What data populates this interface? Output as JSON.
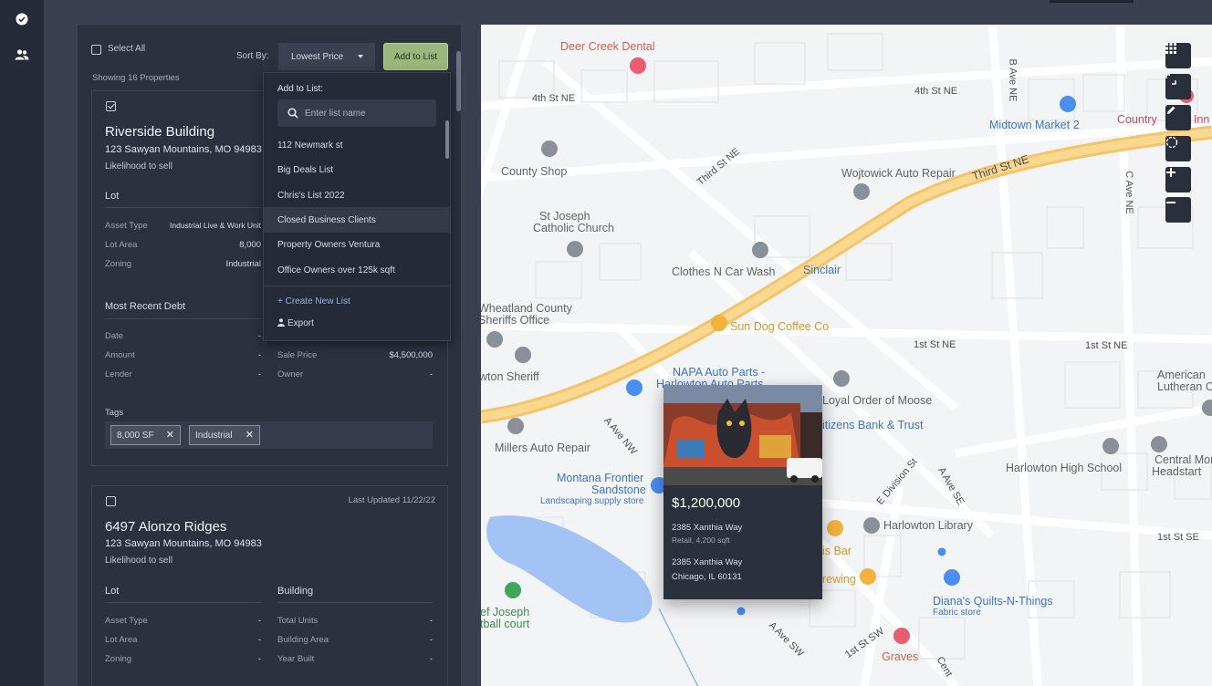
{
  "nav": {
    "items": [
      {
        "icon": "check-circle-icon"
      },
      {
        "icon": "users-icon"
      }
    ]
  },
  "list": {
    "select_all": "Select All",
    "sort_by_label": "Sort By:",
    "sort_value": "Lowest Price",
    "add_to_list": "Add to List",
    "showing": "Showing 16 Properties"
  },
  "dropdown": {
    "header": "Add to List:",
    "search_placeholder": "Enter list name",
    "items": [
      "112 Newmark st",
      "Big Deals List",
      "Chris's List 2022",
      "Closed Business Clients",
      "Property Owners Ventura",
      "Office Owners over 125k sqft"
    ],
    "create_new": "+ Create New List",
    "export": "Export"
  },
  "cards": [
    {
      "title": "Riverside Building",
      "address": "123 Sawyan Mountains, MO 94983",
      "likelihood": "Likelihood to sell",
      "lot_heading": "Lot",
      "asset_type_label": "Asset Type",
      "asset_type": "Industrial Live & Work Unit",
      "lot_area_label": "Lot Area",
      "lot_area": "8,000",
      "zoning_label": "Zoning",
      "zoning": "Industrial",
      "debt_heading": "Most Recent Debt",
      "date_label": "Date",
      "date": "-",
      "amount_label": "Amount",
      "amount": "-",
      "lender_label": "Lender",
      "lender": "-",
      "sale_price_label": "Sale Price",
      "sale_price": "$4,500,000",
      "owner_label": "Owner",
      "owner": "-",
      "tags_label": "Tags",
      "tags": [
        "8,000 SF",
        "Industrial"
      ]
    },
    {
      "last_updated": "Last Updated 11/22/22",
      "title": "6497 Alonzo Ridges",
      "address": "123 Sawyan Mountains, MO 94983",
      "likelihood": "Likelihood to sell",
      "lot_heading": "Lot",
      "building_heading": "Building",
      "asset_type_label": "Asset Type",
      "asset_type": "-",
      "lot_area_label": "Lot Area",
      "lot_area": "-",
      "zoning_label": "Zoning",
      "zoning": "-",
      "total_units_label": "Total Units",
      "total_units": "-",
      "building_area_label": "Building Area",
      "building_area": "-",
      "year_built_label": "Year Built",
      "year_built": "-"
    }
  ],
  "map": {
    "pois": {
      "deer_creek": "Deer Creek Dental",
      "midtown": "Midtown Market 2",
      "country": "Country",
      "inn": "Inn",
      "county_shop": "County Shop",
      "wojtowick": "Wojtowick Auto Repair",
      "st_joseph_1": "St Joseph",
      "st_joseph_2": "Catholic Church",
      "clothes": "Clothes N Car Wash",
      "sinclair": "Sinclair",
      "wheatland_1": "Wheatland County",
      "wheatland_2": "Sheriffs Office",
      "sun_dog": "Sun Dog Coffee Co",
      "town_sheriff": "wton Sheriff",
      "napa_1": "NAPA Auto Parts -",
      "napa_2": "Harlowton Auto Parts",
      "loyal": "Loyal Order of Moose",
      "citizens": "itizens Bank & Trust",
      "american_1": "American",
      "american_2": "Lutheran Chu",
      "millers": "Millers Auto Repair",
      "harlowton_hs": "Harlowton High School",
      "central_1": "Central Montan",
      "central_2": "Headstart",
      "montana_1": "Montana Frontier",
      "montana_2": "Sandstone",
      "landscaping": "Landscaping supply store",
      "harlowton_lib": "Harlowton Library",
      "is_bar": "is Bar",
      "brewing": "rewing",
      "dianas": "Diana's Quilts-N-Things",
      "fabric": "Fabric store",
      "joseph_1": "ef Joseph",
      "joseph_2": "tball court",
      "graves": "Graves"
    },
    "streets": {
      "fourth_nw": "4th St NE",
      "fourth_ne": "4th St NE",
      "third_ne_a": "Third St NE",
      "third_ne_b": "Third St NE",
      "b_ave": "B Ave NE",
      "c_ave": "C Ave NE",
      "first_ne_1": "1st St NE",
      "first_ne_2": "1st St NE",
      "a_ave_nw": "A Ave NW",
      "a_ave_se": "A Ave SE",
      "a_ave_sw": "A Ave SW",
      "e_division": "E Division St",
      "first_se": "1st St SE",
      "first_sw": "1st St SW",
      "cent": "Cent"
    }
  },
  "popup": {
    "price": "$1,200,000",
    "address1": "2385 Xanthia Way",
    "detail": "Retail, 4,200 sqft",
    "address2": "2385 Xanthia Way",
    "city": "Chicago, IL 60131"
  }
}
